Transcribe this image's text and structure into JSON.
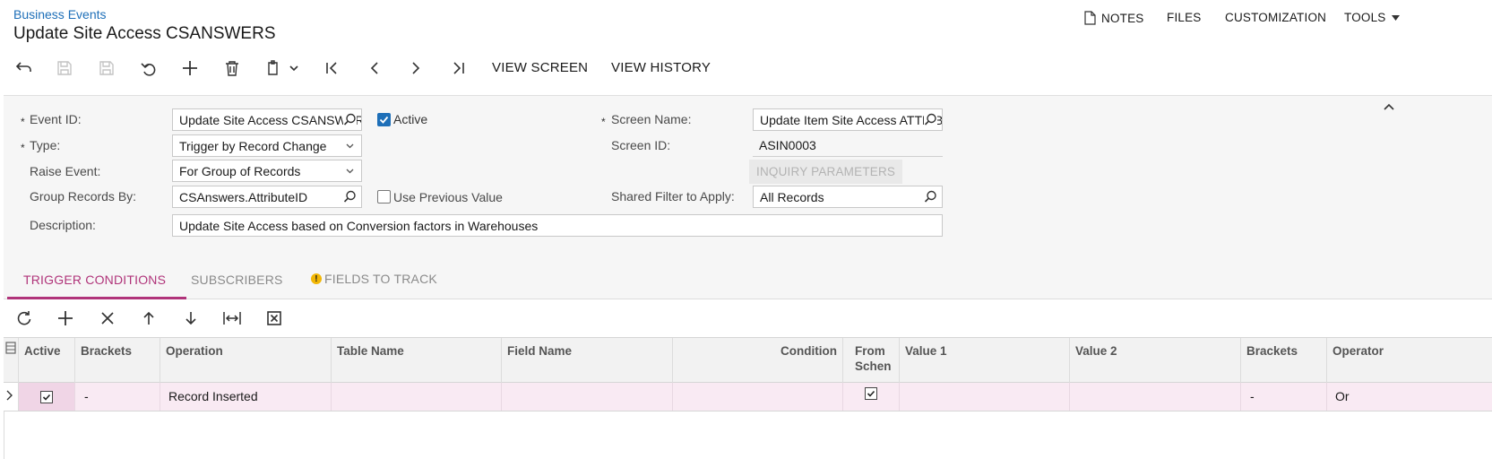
{
  "header": {
    "breadcrumb": "Business Events",
    "title": "Update Site Access CSANSWERS",
    "menu": {
      "notes": "NOTES",
      "files": "FILES",
      "customization": "CUSTOMIZATION",
      "tools": "TOOLS"
    }
  },
  "toolbar": {
    "view_screen": "VIEW SCREEN",
    "view_history": "VIEW HISTORY"
  },
  "form": {
    "event_id_label": "Event ID:",
    "event_id_value": "Update Site Access CSANSWERS",
    "active_label": "Active",
    "active_checked": true,
    "type_label": "Type:",
    "type_value": "Trigger by Record Change",
    "raise_event_label": "Raise Event:",
    "raise_event_value": "For Group of Records",
    "group_by_label": "Group Records By:",
    "group_by_value": "CSAnswers.AttributeID",
    "use_prev_label": "Use Previous Value",
    "use_prev_checked": false,
    "description_label": "Description:",
    "description_value": "Update Site Access based on Conversion factors in Warehouses",
    "screen_name_label": "Screen Name:",
    "screen_name_value": "Update Item Site Access ATTRIBUTES",
    "screen_id_label": "Screen ID:",
    "screen_id_value": "ASIN0003",
    "inquiry_button": "INQUIRY PARAMETERS",
    "shared_filter_label": "Shared Filter to Apply:",
    "shared_filter_value": "All Records",
    "required_mark": "*"
  },
  "tabs": {
    "trigger_conditions": "TRIGGER CONDITIONS",
    "subscribers": "SUBSCRIBERS",
    "fields_to_track": "FIELDS TO TRACK",
    "warning_glyph": "!"
  },
  "grid": {
    "columns": {
      "active": "Active",
      "brackets_open": "Brackets",
      "operation": "Operation",
      "table_name": "Table Name",
      "field_name": "Field Name",
      "condition": "Condition",
      "from_schema_1": "From",
      "from_schema_2": "Schen",
      "value1": "Value 1",
      "value2": "Value 2",
      "brackets_close": "Brackets",
      "operator": "Operator"
    },
    "rows": [
      {
        "active": true,
        "brackets_open": "-",
        "operation": "Record Inserted",
        "table_name": "",
        "field_name": "",
        "condition": "",
        "from_schema": true,
        "value1": "",
        "value2": "",
        "brackets_close": "-",
        "operator": "Or"
      }
    ]
  },
  "colors": {
    "link": "#1e6fb8",
    "active_tab": "#b0347a",
    "selected_row": "#f9eaf3",
    "panel_bg": "#f6f6f6",
    "warning": "#f2b705"
  }
}
